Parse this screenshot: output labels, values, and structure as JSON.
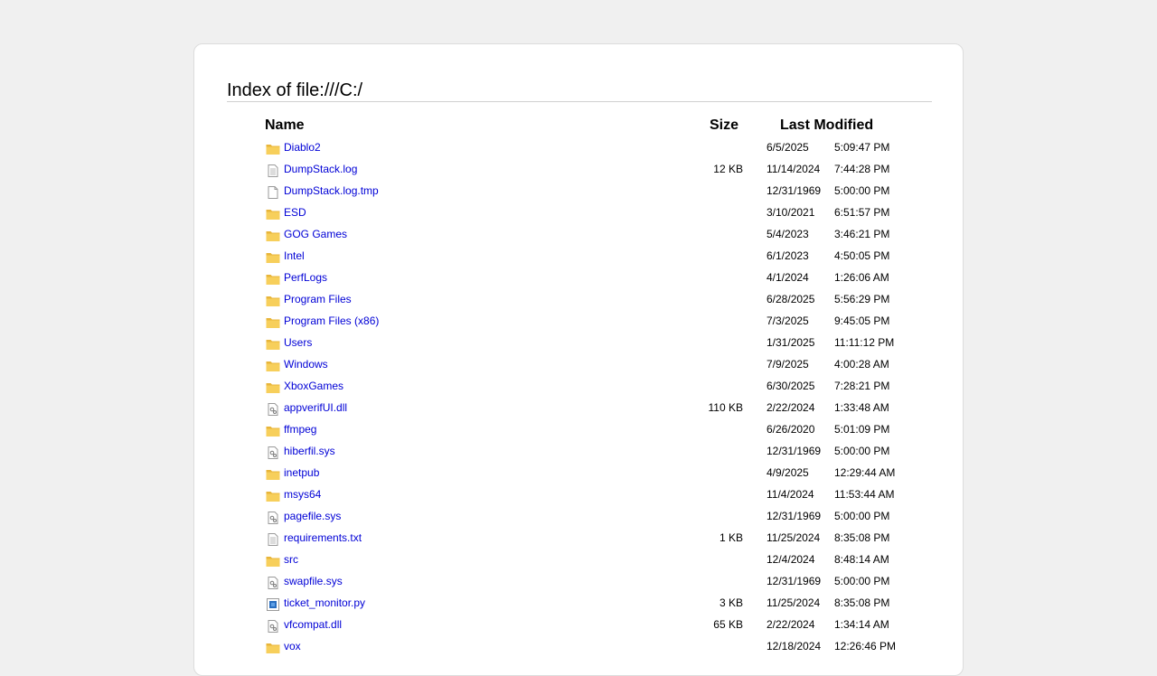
{
  "title": "Index of file:///C:/",
  "columns": {
    "name": "Name",
    "size": "Size",
    "modified": "Last Modified"
  },
  "colors": {
    "link": "#0000d6",
    "folder": "#f5c542",
    "background": "#f0f0f0"
  },
  "entries": [
    {
      "name": "Diablo2",
      "type": "folder",
      "size": "",
      "date": "6/5/2025",
      "time": "5:09:47 PM"
    },
    {
      "name": "DumpStack.log",
      "type": "text-file",
      "size": "12 KB",
      "date": "11/14/2024",
      "time": "7:44:28 PM"
    },
    {
      "name": "DumpStack.log.tmp",
      "type": "blank-file",
      "size": "",
      "date": "12/31/1969",
      "time": "5:00:00 PM"
    },
    {
      "name": "ESD",
      "type": "folder",
      "size": "",
      "date": "3/10/2021",
      "time": "6:51:57 PM"
    },
    {
      "name": "GOG Games",
      "type": "folder",
      "size": "",
      "date": "5/4/2023",
      "time": "3:46:21 PM"
    },
    {
      "name": "Intel",
      "type": "folder",
      "size": "",
      "date": "6/1/2023",
      "time": "4:50:05 PM"
    },
    {
      "name": "PerfLogs",
      "type": "folder",
      "size": "",
      "date": "4/1/2024",
      "time": "1:26:06 AM"
    },
    {
      "name": "Program Files",
      "type": "folder",
      "size": "",
      "date": "6/28/2025",
      "time": "5:56:29 PM"
    },
    {
      "name": "Program Files (x86)",
      "type": "folder",
      "size": "",
      "date": "7/3/2025",
      "time": "9:45:05 PM"
    },
    {
      "name": "Users",
      "type": "folder",
      "size": "",
      "date": "1/31/2025",
      "time": "11:11:12 PM"
    },
    {
      "name": "Windows",
      "type": "folder",
      "size": "",
      "date": "7/9/2025",
      "time": "4:00:28 AM"
    },
    {
      "name": "XboxGames",
      "type": "folder",
      "size": "",
      "date": "6/30/2025",
      "time": "7:28:21 PM"
    },
    {
      "name": "appverifUI.dll",
      "type": "system-file",
      "size": "110 KB",
      "date": "2/22/2024",
      "time": "1:33:48 AM"
    },
    {
      "name": "ffmpeg",
      "type": "folder",
      "size": "",
      "date": "6/26/2020",
      "time": "5:01:09 PM"
    },
    {
      "name": "hiberfil.sys",
      "type": "system-file",
      "size": "",
      "date": "12/31/1969",
      "time": "5:00:00 PM"
    },
    {
      "name": "inetpub",
      "type": "folder",
      "size": "",
      "date": "4/9/2025",
      "time": "12:29:44 AM"
    },
    {
      "name": "msys64",
      "type": "folder",
      "size": "",
      "date": "11/4/2024",
      "time": "11:53:44 AM"
    },
    {
      "name": "pagefile.sys",
      "type": "system-file",
      "size": "",
      "date": "12/31/1969",
      "time": "5:00:00 PM"
    },
    {
      "name": "requirements.txt",
      "type": "text-file",
      "size": "1 KB",
      "date": "11/25/2024",
      "time": "8:35:08 PM"
    },
    {
      "name": "src",
      "type": "folder",
      "size": "",
      "date": "12/4/2024",
      "time": "8:48:14 AM"
    },
    {
      "name": "swapfile.sys",
      "type": "system-file",
      "size": "",
      "date": "12/31/1969",
      "time": "5:00:00 PM"
    },
    {
      "name": "ticket_monitor.py",
      "type": "python-file",
      "size": "3 KB",
      "date": "11/25/2024",
      "time": "8:35:08 PM"
    },
    {
      "name": "vfcompat.dll",
      "type": "system-file",
      "size": "65 KB",
      "date": "2/22/2024",
      "time": "1:34:14 AM"
    },
    {
      "name": "vox",
      "type": "folder",
      "size": "",
      "date": "12/18/2024",
      "time": "12:26:46 PM"
    }
  ]
}
